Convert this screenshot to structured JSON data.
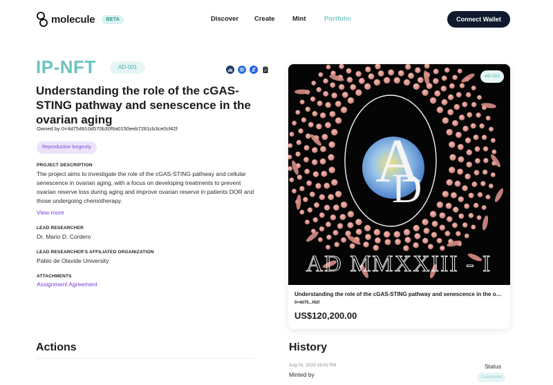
{
  "header": {
    "brand": "molecule",
    "beta_label": "BETA",
    "nav": [
      {
        "label": "Discover"
      },
      {
        "label": "Create"
      },
      {
        "label": "Mint"
      },
      {
        "label": "Portfolio",
        "active": true
      }
    ],
    "connect_label": "Connect Wallet"
  },
  "ipnft": {
    "heading": "IP-NFT",
    "id": "AD-001",
    "icons": [
      "chart-icon",
      "dropbox-icon",
      "zora-icon",
      "clipboard-icon"
    ],
    "title": "Understanding the role of the cGAS-STING pathway and senescence in the ovarian aging",
    "owned_by": "Owned by 0×4d754910d570b30f9a0150eeb7281cb3ce0cf42f",
    "tag": "Reproductive longevity",
    "description_label": "PROJECT DESCRIPTION",
    "description": "The project aims to investigate the role of the cGAS-STING pathway and cellular senescence in ovarian aging, with a focus on developing treatments to prevent ovarian reserve loss during aging and improve ovarian reserve in patients DOR and those undergoing chemotherapy.",
    "view_more": "View more",
    "researcher_label": "LEAD RESEARCHER",
    "researcher": "Dr. Mario D. Cordero",
    "org_label": "LEAD RESEARCHER'S AFFILIATED ORGANIZATION",
    "org": "Pablo de Olavide University",
    "attachments_label": "ATTACHMENTS",
    "attachment": "Assignment Agreement"
  },
  "card": {
    "badge": "AD-001",
    "art_text": "AD MMXXIII - I",
    "title": "Understanding the role of the cGAS-STING pathway and senescence in the ovarian aging",
    "owner": "0×4d75...f42f",
    "price": "US$120,200.00"
  },
  "actions": {
    "title": "Actions"
  },
  "history": {
    "title": "History",
    "status_label": "Status",
    "entries": [
      {
        "date": "Aug 01, 2023 19:41 PM",
        "action": "Minted by",
        "status": "Completed"
      }
    ]
  },
  "colors": {
    "accent_teal": "#6cc3c1",
    "link_purple": "#7a3fc9",
    "button_dark": "#0f1a2e"
  }
}
